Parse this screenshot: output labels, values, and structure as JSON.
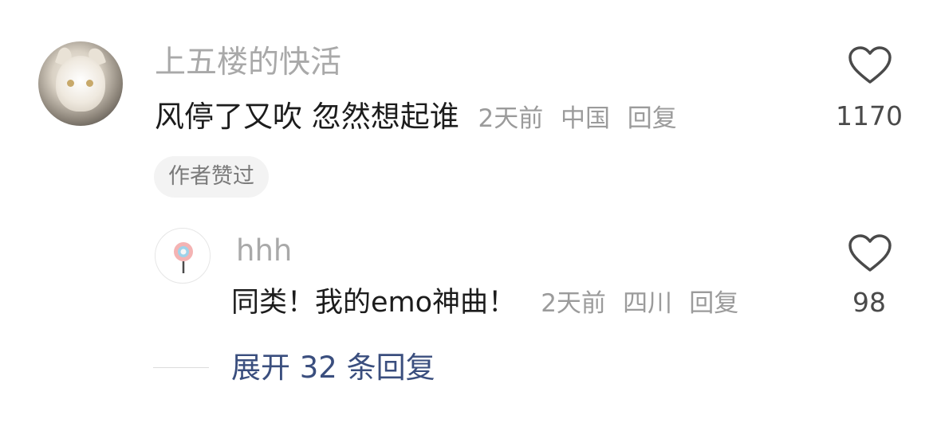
{
  "comment": {
    "username": "上五楼的快活",
    "text": "风停了又吹 忽然想起谁",
    "time": "2天前",
    "location": "中国",
    "reply_label": "回复",
    "like_count": "1170",
    "badge": "作者赞过"
  },
  "reply": {
    "username": "hhh",
    "text": "同类！我的emo神曲！",
    "time": "2天前",
    "location": "四川",
    "reply_label": "回复",
    "like_count": "98"
  },
  "expand": {
    "label": "展开 32 条回复"
  },
  "colors": {
    "username": "#a9a9a9",
    "text": "#1c1c1c",
    "meta": "#9b9b9b",
    "link": "#3a4e7e",
    "badge_bg": "#f3f3f3"
  },
  "icons": {
    "like": "heart-outline-icon",
    "reply_avatar": "lollipop-icon"
  }
}
